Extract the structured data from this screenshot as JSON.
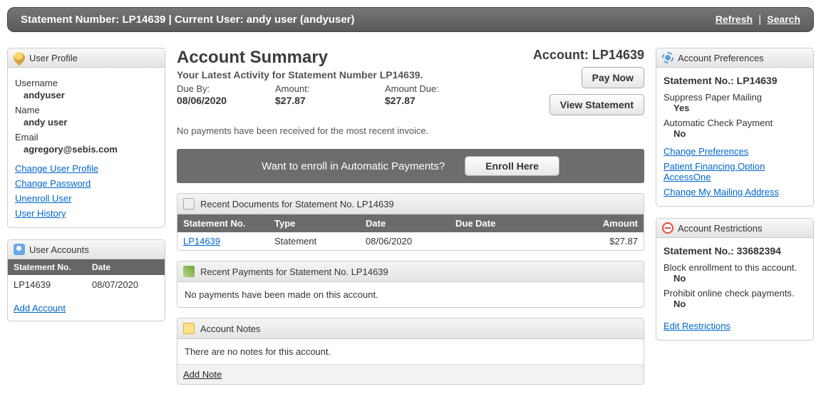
{
  "topbar": {
    "text": "Statement Number: LP14639 | Current User: andy user (andyuser)",
    "refresh": "Refresh",
    "search": "Search",
    "sep": "|"
  },
  "userProfile": {
    "header": "User Profile",
    "username_label": "Username",
    "username": "andyuser",
    "name_label": "Name",
    "name": "andy user",
    "email_label": "Email",
    "email": "agregory@sebis.com",
    "links": {
      "change_profile": "Change User Profile",
      "change_password": "Change Password",
      "unenroll": "Unenroll User",
      "history": "User History"
    }
  },
  "userAccounts": {
    "header": "User Accounts",
    "col_stmt": "Statement No.",
    "col_date": "Date",
    "row": {
      "stmt": "LP14639",
      "date": "08/07/2020"
    },
    "add": "Add Account"
  },
  "summary": {
    "title": "Account Summary",
    "account_line": "Account: LP14639",
    "subtitle": "Your Latest Activity for Statement Number LP14639.",
    "due_by_label": "Due By:",
    "due_by": "08/06/2020",
    "amount_label": "Amount:",
    "amount": "$27.87",
    "amount_due_label": "Amount Due:",
    "amount_due": "$27.87",
    "pay_now": "Pay Now",
    "view_statement": "View Statement",
    "no_payments_msg": "No payments have been received for the most recent invoice."
  },
  "enroll": {
    "text": "Want to enroll in Automatic Payments?",
    "button": "Enroll Here"
  },
  "recentDocs": {
    "header": "Recent Documents for Statement No. LP14639",
    "cols": {
      "stmt": "Statement No.",
      "type": "Type",
      "date": "Date",
      "due": "Due Date",
      "amount": "Amount"
    },
    "row": {
      "stmt": "LP14639",
      "type": "Statement",
      "date": "08/06/2020",
      "due": "",
      "amount": "$27.87"
    }
  },
  "recentPayments": {
    "header": "Recent Payments for Statement No. LP14639",
    "msg": "No payments have been made on this account."
  },
  "notes": {
    "header": "Account Notes",
    "msg": "There are no notes for this account.",
    "add": "Add Note"
  },
  "prefs": {
    "header": "Account Preferences",
    "stmt_line": "Statement No.: LP14639",
    "suppress_label": "Suppress Paper Mailing",
    "suppress_val": "Yes",
    "auto_check_label": "Automatic Check Payment",
    "auto_check_val": "No",
    "links": {
      "change_prefs": "Change Preferences",
      "financing": "Patient Financing Option AccessOne",
      "mailing": "Change My Mailing Address"
    }
  },
  "restrictions": {
    "header": "Account Restrictions",
    "stmt_line": "Statement No.: 33682394",
    "block_label": "Block enrollment to this account.",
    "block_val": "No",
    "prohibit_label": "Prohibit online check payments.",
    "prohibit_val": "No",
    "edit": "Edit Restrictions"
  }
}
